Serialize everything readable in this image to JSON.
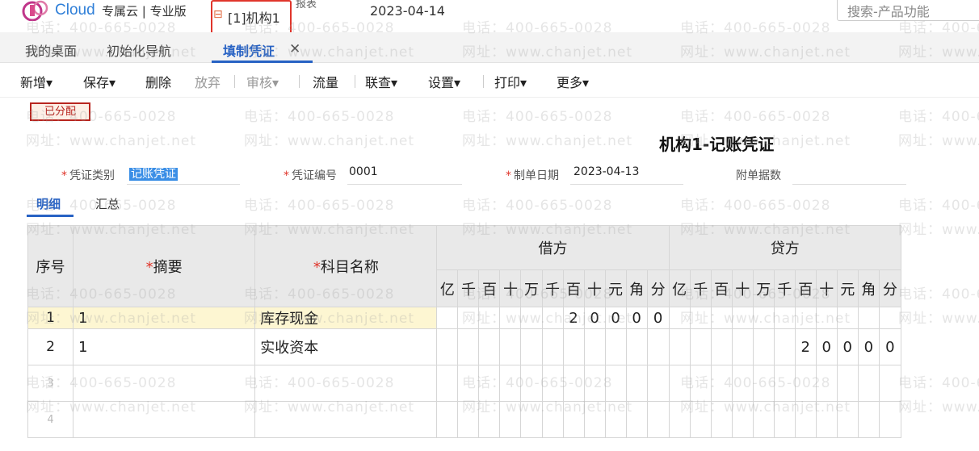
{
  "header": {
    "brand": "Cloud",
    "edition": "专属云 | 专业版",
    "org_name": "[1]机构1",
    "report_menu": "报表",
    "date": "2023-04-14",
    "search_placeholder": "搜索-产品功能"
  },
  "tabs": [
    {
      "label": "我的桌面",
      "active": false
    },
    {
      "label": "初始化导航",
      "active": false
    },
    {
      "label": "填制凭证",
      "active": true
    }
  ],
  "toolbar": {
    "new": "新增",
    "save": "保存",
    "delete": "删除",
    "discard": "放弃",
    "audit": "审核",
    "flow": "流量",
    "query": "联查",
    "settings": "设置",
    "print": "打印",
    "more": "更多"
  },
  "status_badge": "已分配",
  "voucher": {
    "title": "机构1-记账凭证",
    "type_label": "凭证类别",
    "type_value": "记账凭证",
    "number_label": "凭证编号",
    "number_value": "0001",
    "date_label": "制单日期",
    "date_value": "2023-04-13",
    "attachments_label": "附单据数",
    "attachments_value": ""
  },
  "subtabs": {
    "detail": "明细",
    "summary": "汇总"
  },
  "table": {
    "col_seq": "序号",
    "col_summary": "摘要",
    "col_account": "科目名称",
    "col_debit": "借方",
    "col_credit": "贷方",
    "digit_units": [
      "亿",
      "千",
      "百",
      "十",
      "万",
      "千",
      "百",
      "十",
      "元",
      "角",
      "分"
    ],
    "rows": [
      {
        "seq": "1",
        "summary": "1",
        "account": "库存现金",
        "debit": [
          "",
          "",
          "",
          "",
          "",
          "",
          "2",
          "0",
          "0",
          "0",
          "0"
        ],
        "credit": [
          "",
          "",
          "",
          "",
          "",
          "",
          "",
          "",
          "",
          "",
          ""
        ]
      },
      {
        "seq": "2",
        "summary": "1",
        "account": "实收资本",
        "debit": [
          "",
          "",
          "",
          "",
          "",
          "",
          "",
          "",
          "",
          "",
          ""
        ],
        "credit": [
          "",
          "",
          "",
          "",
          "",
          "",
          "2",
          "0",
          "0",
          "0",
          "0"
        ]
      },
      {
        "seq": "3",
        "summary": "",
        "account": "",
        "debit": [],
        "credit": []
      },
      {
        "seq": "4",
        "summary": "",
        "account": "",
        "debit": [],
        "credit": []
      }
    ]
  },
  "watermark": {
    "phone": "电话：400-665-0028",
    "site": "网址：www.chanjet.net"
  },
  "colors": {
    "accent": "#2762c4",
    "highlight_row": "#fdf6d2",
    "badge_red": "#b8251f"
  }
}
